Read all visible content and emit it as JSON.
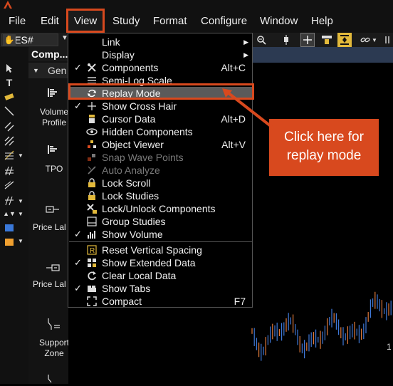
{
  "menubar": {
    "items": [
      "File",
      "Edit",
      "View",
      "Study",
      "Format",
      "Configure",
      "Window",
      "Help"
    ]
  },
  "toolbar": {
    "symbol": "@ES#"
  },
  "components_panel": {
    "title": "Comp...",
    "group": "Gen",
    "items": [
      {
        "label": "Volume Profile"
      },
      {
        "label": "TPO"
      },
      {
        "label": "Price Lal"
      },
      {
        "label": "Price Lal"
      },
      {
        "label": "Support Zone"
      }
    ]
  },
  "view_menu": {
    "items": [
      {
        "label": "Link",
        "checked": false,
        "shortcut": "",
        "submenu": true,
        "icon": "",
        "disabled": false
      },
      {
        "label": "Display",
        "checked": false,
        "shortcut": "",
        "submenu": true,
        "icon": "",
        "disabled": false
      },
      {
        "label": "Components",
        "checked": true,
        "shortcut": "Alt+C",
        "submenu": false,
        "icon": "tools-icon",
        "disabled": false
      },
      {
        "label": "Semi-Log Scale",
        "checked": false,
        "shortcut": "",
        "submenu": false,
        "icon": "lines-icon",
        "disabled": false
      },
      {
        "label": "Replay Mode",
        "checked": false,
        "shortcut": "",
        "submenu": false,
        "icon": "replay-icon",
        "disabled": false,
        "selected": true
      },
      {
        "label": "Show Cross Hair",
        "checked": true,
        "shortcut": "",
        "submenu": false,
        "icon": "crosshair-icon",
        "disabled": false
      },
      {
        "label": "Cursor Data",
        "checked": false,
        "shortcut": "Alt+D",
        "submenu": false,
        "icon": "cursor-data-icon",
        "disabled": false
      },
      {
        "label": "Hidden Components",
        "checked": false,
        "shortcut": "",
        "submenu": false,
        "icon": "eye-icon",
        "disabled": false
      },
      {
        "label": "Object Viewer",
        "checked": false,
        "shortcut": "Alt+V",
        "submenu": false,
        "icon": "object-viewer-icon",
        "disabled": false
      },
      {
        "label": "Snap Wave Points",
        "checked": false,
        "shortcut": "",
        "submenu": false,
        "icon": "snap-icon",
        "disabled": true
      },
      {
        "label": "Auto Analyze",
        "checked": false,
        "shortcut": "",
        "submenu": false,
        "icon": "wand-icon",
        "disabled": true
      },
      {
        "label": "Lock Scroll",
        "checked": false,
        "shortcut": "",
        "submenu": false,
        "icon": "lock-icon",
        "disabled": false
      },
      {
        "label": "Lock Studies",
        "checked": false,
        "shortcut": "",
        "submenu": false,
        "icon": "lock-icon",
        "disabled": false
      },
      {
        "label": "Lock/Unlock Components",
        "checked": false,
        "shortcut": "",
        "submenu": false,
        "icon": "tools-lock-icon",
        "disabled": false
      },
      {
        "label": "Group Studies",
        "checked": false,
        "shortcut": "",
        "submenu": false,
        "icon": "group-icon",
        "disabled": false
      },
      {
        "label": "Show Volume",
        "checked": true,
        "shortcut": "",
        "submenu": false,
        "icon": "volume-icon",
        "disabled": false
      },
      {
        "label": "Reset Vertical Spacing",
        "checked": false,
        "shortcut": "",
        "submenu": false,
        "icon": "reset-spacing-icon",
        "disabled": false
      },
      {
        "label": "Show Extended Data",
        "checked": true,
        "shortcut": "",
        "submenu": false,
        "icon": "extended-data-icon",
        "disabled": false
      },
      {
        "label": "Clear Local Data",
        "checked": false,
        "shortcut": "",
        "submenu": false,
        "icon": "clear-icon",
        "disabled": false
      },
      {
        "label": "Show Tabs",
        "checked": true,
        "shortcut": "",
        "submenu": false,
        "icon": "tabs-icon",
        "disabled": false
      },
      {
        "label": "Compact",
        "checked": false,
        "shortcut": "F7",
        "submenu": false,
        "icon": "compact-icon",
        "disabled": false
      }
    ]
  },
  "callout": {
    "text": "Click here for replay mode"
  },
  "colors": {
    "accent": "#d8491e",
    "menu_bg": "#000000",
    "selected_bg": "#5a5a5a",
    "disabled_text": "#7a7a7a"
  }
}
